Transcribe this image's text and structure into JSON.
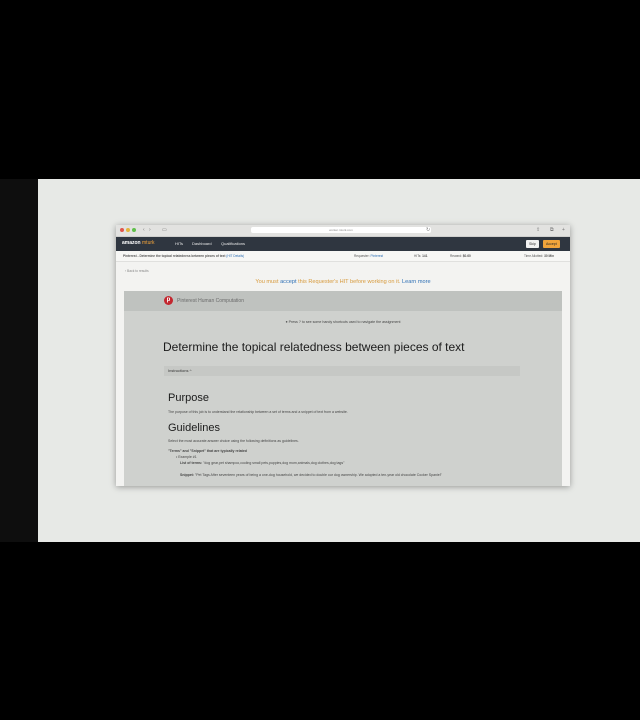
{
  "browser": {
    "url": "worker.mturk.com"
  },
  "nav": {
    "logo_main": "amazon",
    "logo_sub": "mturk",
    "links": [
      "HITs",
      "Dashboard",
      "Qualifications"
    ],
    "skip_label": "Skip",
    "accept_label": "Accept"
  },
  "hit_bar": {
    "title": "Pinterest - Determine the topical relatedness between pieces of text",
    "details_link": "(HIT Details)",
    "requester_label": "Requester:",
    "requester_value": "Pinterest",
    "hits_label": "HITs:",
    "hits_value": "141",
    "reward_label": "Reward:",
    "reward_value": "$0.60",
    "time_label": "Time Allotted:",
    "time_value": "30 Min"
  },
  "back_link": "‹ Back to results",
  "notice": {
    "pre": "You must ",
    "accept_link": "accept",
    "mid": " this Requester's HIT before working on it. ",
    "learn_link": "Learn more"
  },
  "panel": {
    "brand": "Pinterest Human Computation",
    "shortcut_tip": "Press ? to see some handy shortcuts used to navigate the assignment",
    "task_title": "Determine the topical relatedness between pieces of text",
    "instructions_label": "Instructions ^",
    "purpose_heading": "Purpose",
    "purpose_text": "The purpose of this job is to understand the relationship between a set of terms and a snippet of text from a website.",
    "guidelines_heading": "Guidelines",
    "guidelines_text": "Select the most accurate answer choice using the following definitions as guidelines.",
    "related_heading": "\"Terms\" and \"Snippet\" that are typically related",
    "example_label": "Example #1",
    "terms_label": "List of terms:",
    "terms_value": "\"dog gear,pet shampoo,cooling small pets,puppies,dog mom,animals,dog clothes,dog tags\"",
    "snippet_label": "Snippet:",
    "snippet_value": "\"Pet Tags After seventeen years of being a one-dog household, we decided to double our dog ownership. We adopted a ten-year old chocolate Cocker Spaniel\""
  }
}
